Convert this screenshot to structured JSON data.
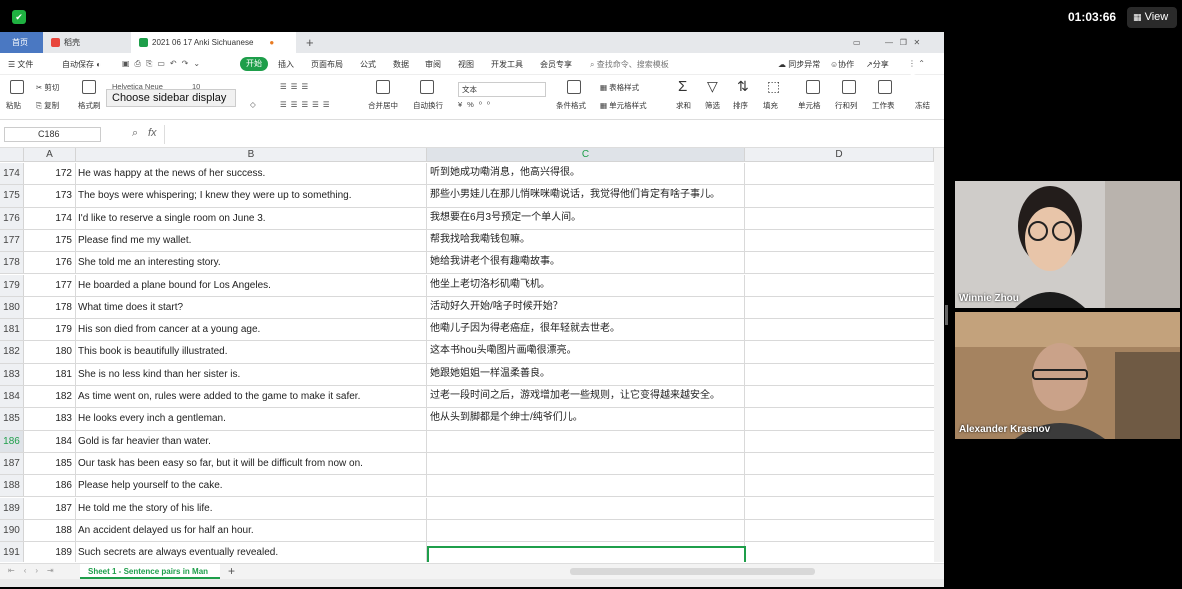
{
  "zoom": {
    "timer": "01:03:66",
    "view_label": "View"
  },
  "tabs": {
    "home": "首页",
    "store": "稻壳",
    "doc": "2021 06 17 Anki Sichuanese"
  },
  "menu": {
    "file": "文件",
    "autosave": "自动保存",
    "start": "开始",
    "insert": "插入",
    "layout": "页面布局",
    "formula": "公式",
    "data": "数据",
    "review": "审阅",
    "view": "视图",
    "dev": "开发工具",
    "member": "会员专享",
    "search": "查找命令、搜索模板",
    "sync": "同步异常",
    "collab": "协作",
    "share": "分享"
  },
  "ribbon": {
    "paste": "粘贴",
    "cut": "剪切",
    "copy": "复制",
    "format_painter": "格式刷",
    "font": "Helvetica Neue",
    "size": "10",
    "merge": "合并居中",
    "wrap": "自动换行",
    "numfmt": "文本",
    "condfmt": "条件格式",
    "table_style": "表格样式",
    "cell_style": "单元格样式",
    "sum": "求和",
    "filter": "筛选",
    "sort": "排序",
    "fill": "填充",
    "cell": "单元格",
    "rowcol": "行和列",
    "sheet": "工作表",
    "freeze": "冻结"
  },
  "tooltip": "Choose sidebar display",
  "namebox": "C186",
  "fx": "fx",
  "columns": [
    "A",
    "B",
    "C",
    "D"
  ],
  "rows": [
    {
      "n": "174",
      "a": "172",
      "b": "He was happy at the news of her success.",
      "c": "听到她成功嘞消息，他高兴得很。"
    },
    {
      "n": "175",
      "a": "173",
      "b": "The boys were whispering; I knew they were up to something.",
      "c": "那些小男娃儿在那儿悄咪咪嘞说话，我觉得他们肯定有啥子事儿。"
    },
    {
      "n": "176",
      "a": "174",
      "b": "I'd like to reserve a single room on June 3.",
      "c": "我想要在6月3号预定一个单人间。"
    },
    {
      "n": "177",
      "a": "175",
      "b": "Please find me my wallet.",
      "c": "帮我找哈我嘞钱包嘛。"
    },
    {
      "n": "178",
      "a": "176",
      "b": "She told me an interesting story.",
      "c": "她给我讲老个很有趣嘞故事。"
    },
    {
      "n": "179",
      "a": "177",
      "b": "He boarded a plane bound for Los Angeles.",
      "c": "他坐上老切洛杉矶嘞飞机。"
    },
    {
      "n": "180",
      "a": "178",
      "b": "What time does it start?",
      "c": "活动好久开始/啥子时候开始？"
    },
    {
      "n": "181",
      "a": "179",
      "b": "His son died from cancer at a young age.",
      "c": "他嘞儿子因为得老癌症，很年轻就去世老。"
    },
    {
      "n": "182",
      "a": "180",
      "b": "This book is beautifully illustrated.",
      "c": "这本书hou头嘞图片画嘞很漂亮。"
    },
    {
      "n": "183",
      "a": "181",
      "b": "She is no less kind than her sister is.",
      "c": "她跟她姐姐一样温柔善良。"
    },
    {
      "n": "184",
      "a": "182",
      "b": "As time went on, rules were added to the game to make it safer.",
      "c": "过老一段时间之后，游戏增加老一些规则，让它变得越来越安全。"
    },
    {
      "n": "185",
      "a": "183",
      "b": "He looks every inch a gentleman.",
      "c": "他从头到脚都是个绅士/纯爷们儿。"
    },
    {
      "n": "186",
      "a": "184",
      "b": "Gold is far heavier than water.",
      "c": ""
    },
    {
      "n": "187",
      "a": "185",
      "b": "Our task has been easy so far, but it will be difficult from now on.",
      "c": ""
    },
    {
      "n": "188",
      "a": "186",
      "b": "Please help yourself to the cake.",
      "c": ""
    },
    {
      "n": "189",
      "a": "187",
      "b": "He told me the story of his life.",
      "c": ""
    },
    {
      "n": "190",
      "a": "188",
      "b": "An accident delayed us for half an hour.",
      "c": ""
    },
    {
      "n": "191",
      "a": "189",
      "b": "Such secrets are always eventually revealed.",
      "c": ""
    }
  ],
  "sheet_tab": "Sheet 1 - Sentence pairs in Man",
  "participants": [
    {
      "name": "Winnie Zhou"
    },
    {
      "name": "Alexander Krasnov"
    }
  ],
  "colors": {
    "accent": "#1e9e4a",
    "home_tab": "#4a78c2"
  }
}
